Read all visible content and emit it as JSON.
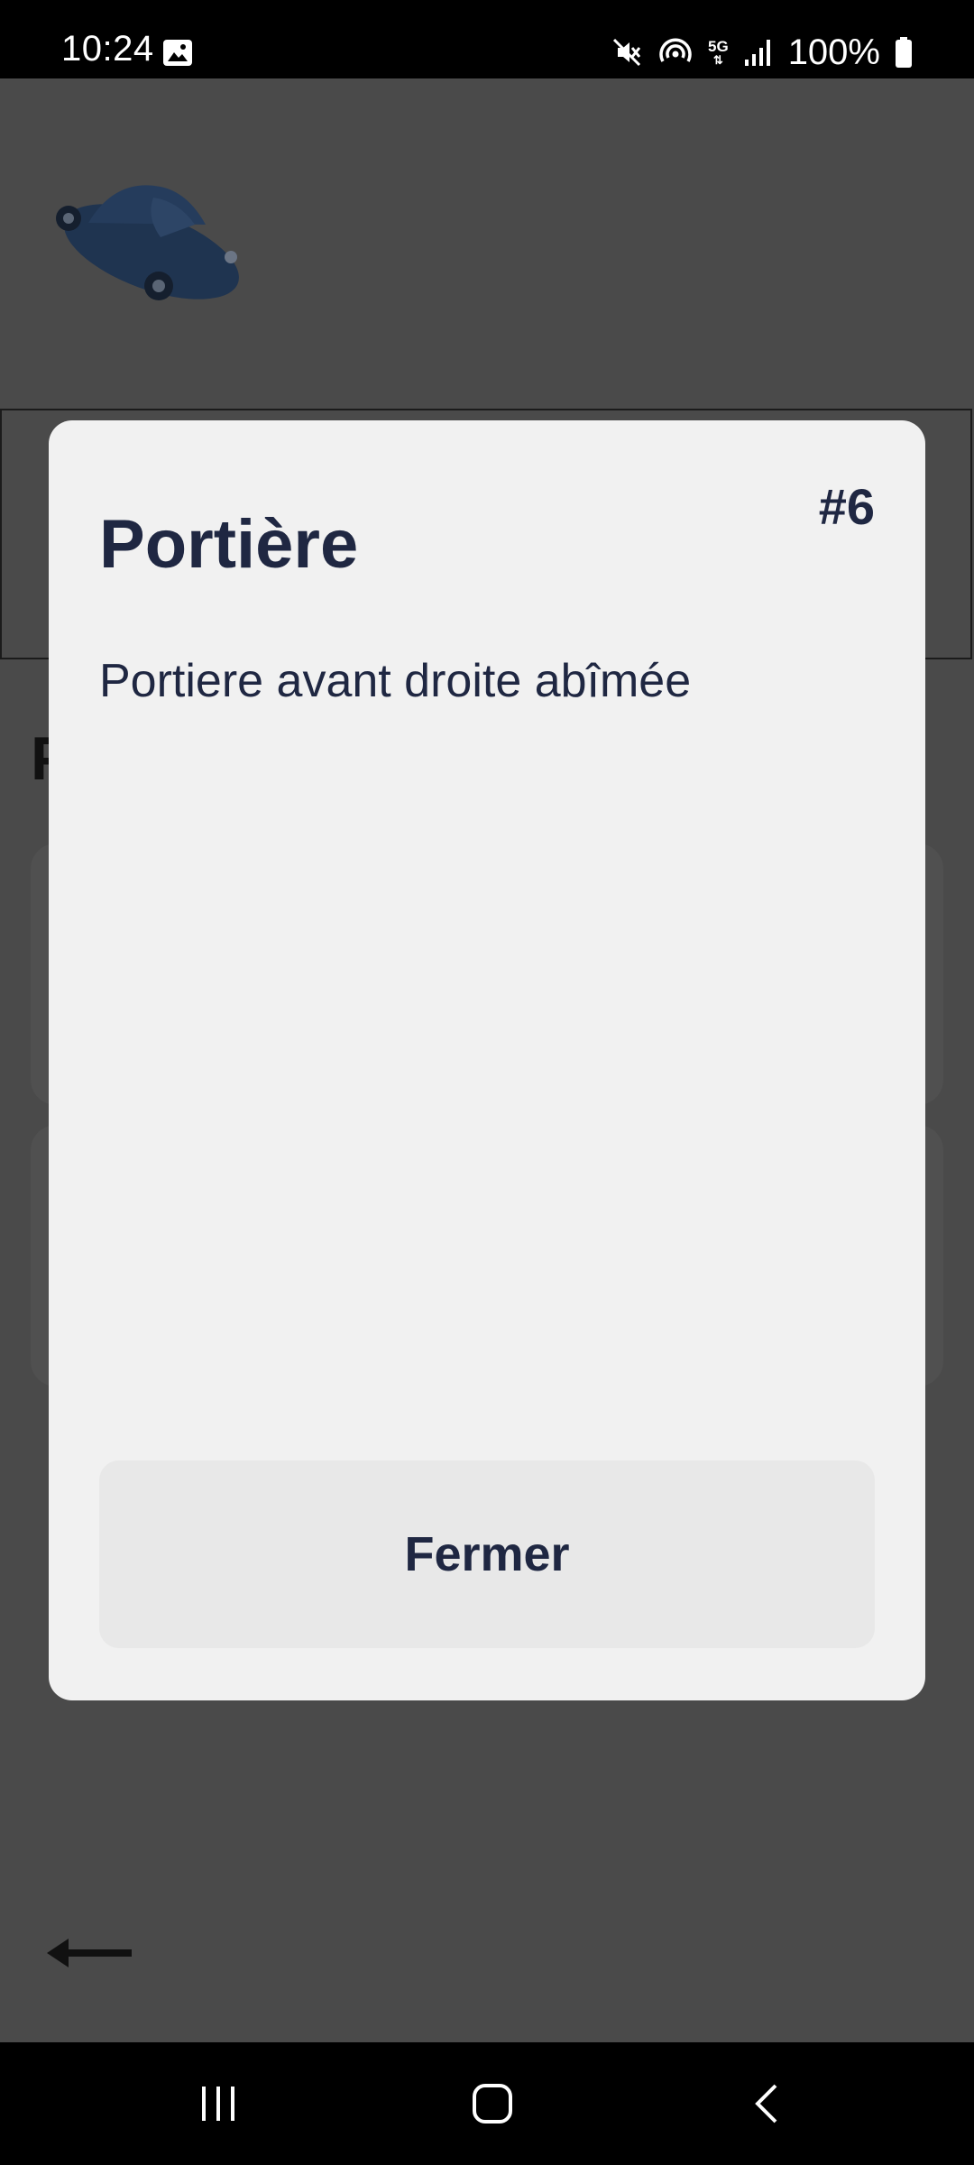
{
  "status_bar": {
    "time": "10:24",
    "network": "5G",
    "battery": "100%",
    "icons": [
      "gallery-icon",
      "mute-icon",
      "hotspot-icon",
      "network-5g-icon",
      "signal-icon",
      "battery-icon"
    ]
  },
  "background": {
    "car_icon": "car-icon",
    "heading_glyph": "P",
    "back_icon": "arrow-left-icon"
  },
  "modal": {
    "title": "Portière",
    "number": "#6",
    "description": "Portiere avant droite abîmée",
    "close_button_label": "Fermer"
  },
  "nav_bar": {
    "icons": [
      "recents-icon",
      "home-icon",
      "back-icon"
    ]
  },
  "colors": {
    "overlay_background": "#4a4a4a",
    "modal_background": "#f1f1f1",
    "button_background": "#e8e8e8",
    "text_primary": "#1f2742",
    "car_body": "#1f3450"
  }
}
